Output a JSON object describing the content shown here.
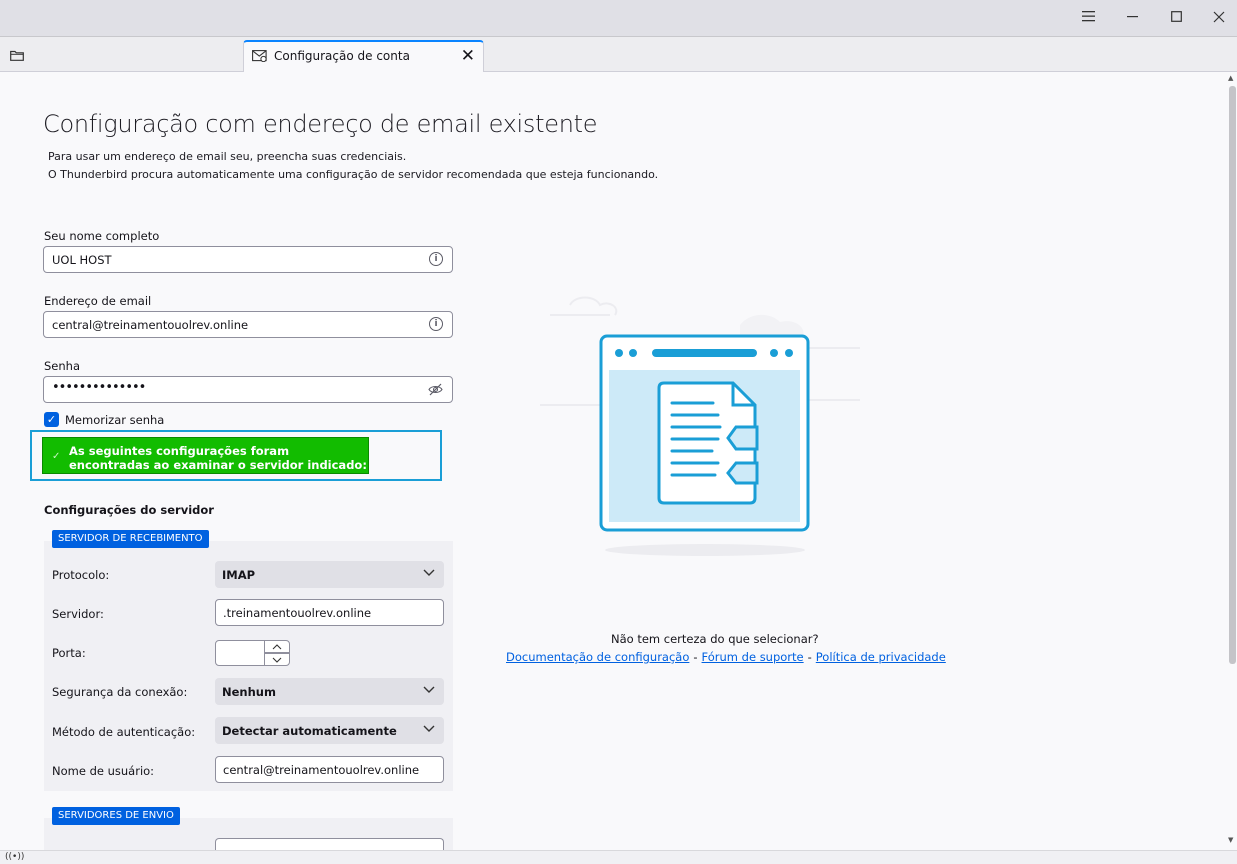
{
  "window": {
    "menu_icon": "hamburger-menu-icon",
    "minimize_icon": "minimize-icon",
    "maximize_icon": "maximize-icon",
    "close_icon": "close-icon"
  },
  "tabs": {
    "folder_icon": "folder-icon",
    "active": {
      "label": "Configuração de conta",
      "icon": "account-settings-icon"
    }
  },
  "page": {
    "title": "Configuração com endereço de email existente",
    "desc_line1": "Para usar um endereço de email seu, preencha suas credenciais.",
    "desc_line2": "O Thunderbird procura automaticamente uma configuração de servidor recomendada que esteja funcionando."
  },
  "form": {
    "name_label": "Seu nome completo",
    "name_value": "UOL HOST",
    "email_label": "Endereço de email",
    "email_value": "central@treinamentouolrev.online",
    "password_label": "Senha",
    "password_value": "••••••••••••••",
    "remember_label": "Memorizar senha",
    "remember_checked": true
  },
  "notice": {
    "text": "As seguintes configurações foram encontradas ao examinar o servidor indicado:"
  },
  "server": {
    "section_title": "Configurações do servidor",
    "incoming_badge": "SERVIDOR DE RECEBIMENTO",
    "protocol_label": "Protocolo:",
    "protocol_value": "IMAP",
    "server_label": "Servidor:",
    "server_value": ".treinamentouolrev.online",
    "port_label": "Porta:",
    "port_value": "",
    "security_label": "Segurança da conexão:",
    "security_value": "Nenhum",
    "auth_label": "Método de autenticação:",
    "auth_value": "Detectar automaticamente",
    "username_label": "Nome de usuário:",
    "username_value": "central@treinamentouolrev.online",
    "outgoing_badge": "SERVIDORES DE ENVIO"
  },
  "help": {
    "question": "Não tem certeza do que selecionar?",
    "link_docs": "Documentação de configuração",
    "link_forum": "Fórum de suporte",
    "link_privacy": "Política de privacidade",
    "separator": "-"
  },
  "colors": {
    "accent": "#0061e0",
    "success": "#12bc00",
    "highlight_frame": "#1a9ed6"
  }
}
